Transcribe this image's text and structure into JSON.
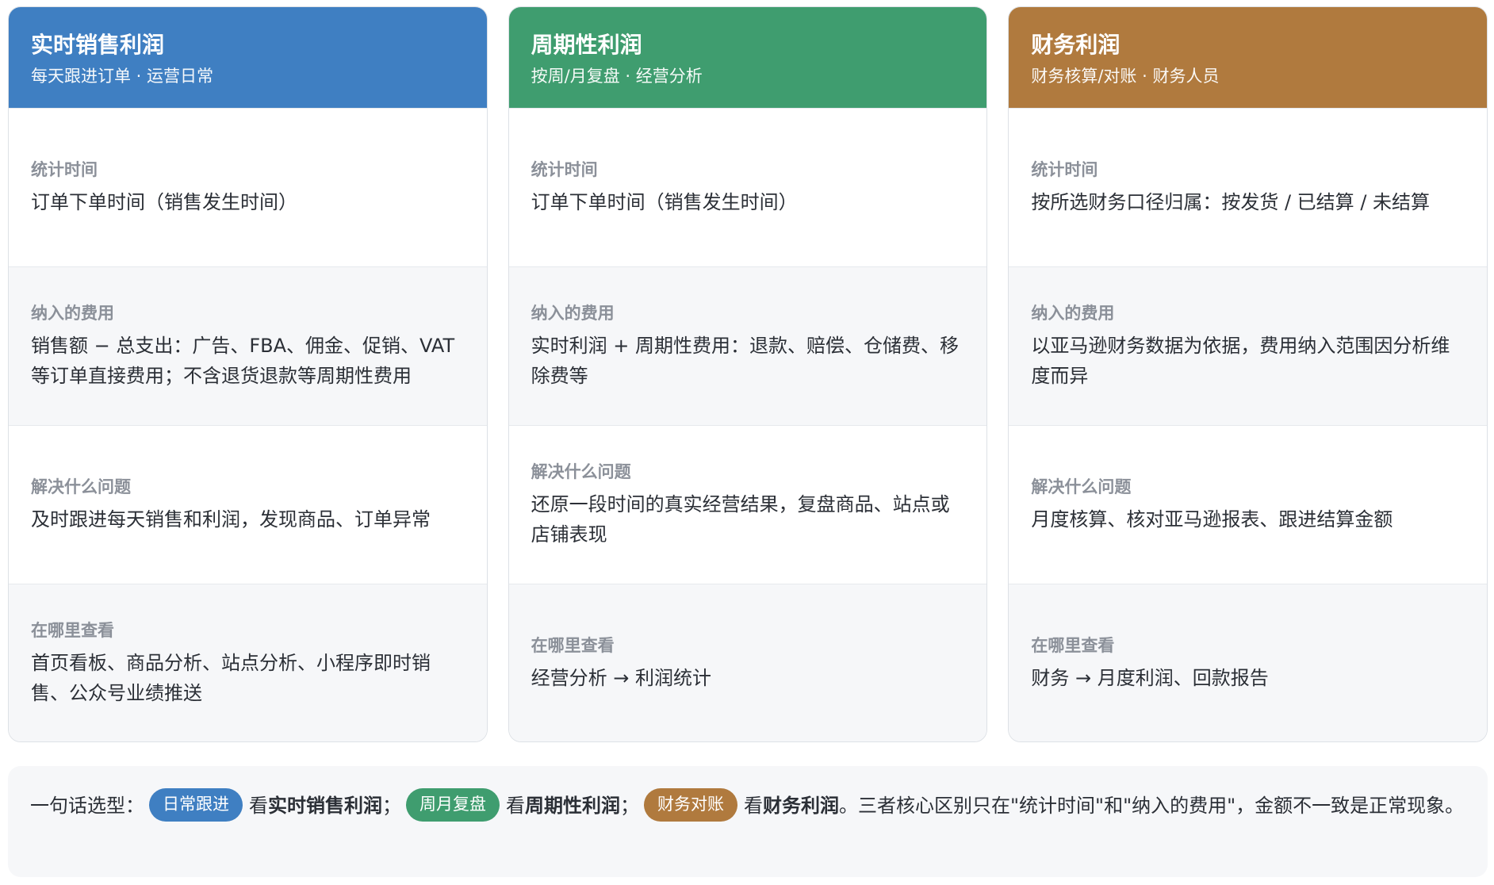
{
  "cards": [
    {
      "title": "实时销售利润",
      "subtitle": "每天跟进订单 · 运营日常",
      "color": "#3f7fc2",
      "sections": [
        {
          "label": "统计时间",
          "value": "订单下单时间（销售发生时间）"
        },
        {
          "label": "纳入的费用",
          "value": "销售额 − 总支出：广告、FBA、佣金、促销、VAT 等订单直接费用；不含退货退款等周期性费用"
        },
        {
          "label": "解决什么问题",
          "value": "及时跟进每天销售和利润，发现商品、订单异常"
        },
        {
          "label": "在哪里查看",
          "value": "首页看板、商品分析、站点分析、小程序即时销售、公众号业绩推送"
        }
      ]
    },
    {
      "title": "周期性利润",
      "subtitle": "按周/月复盘 · 经营分析",
      "color": "#3f9d6f",
      "sections": [
        {
          "label": "统计时间",
          "value": "订单下单时间（销售发生时间）"
        },
        {
          "label": "纳入的费用",
          "value": "实时利润 + 周期性费用：退款、赔偿、仓储费、移除费等"
        },
        {
          "label": "解决什么问题",
          "value": "还原一段时间的真实经营结果，复盘商品、站点或店铺表现"
        },
        {
          "label": "在哪里查看",
          "value": "经营分析 → 利润统计"
        }
      ]
    },
    {
      "title": "财务利润",
      "subtitle": "财务核算/对账 · 财务人员",
      "color": "#b07a3e",
      "sections": [
        {
          "label": "统计时间",
          "value": "按所选财务口径归属：按发货 / 已结算 / 未结算"
        },
        {
          "label": "纳入的费用",
          "value": "以亚马逊财务数据为依据，费用纳入范围因分析维度而异"
        },
        {
          "label": "解决什么问题",
          "value": "月度核算、核对亚马逊报表、跟进结算金额"
        },
        {
          "label": "在哪里查看",
          "value": "财务 → 月度利润、回款报告"
        }
      ]
    }
  ],
  "summary": {
    "lead": "一句话选型：",
    "tag1": "日常跟进",
    "text1": "看",
    "strong1": "实时销售利润",
    "sep1": "；",
    "tag2": "周月复盘",
    "text2": "看",
    "strong2": "周期性利润",
    "sep2": "；",
    "tag3": "财务对账",
    "text3": "看",
    "strong3": "财务利润",
    "tail": "。三者核心区别只在\"统计时间\"和\"纳入的费用\"，金额不一致是正常现象。"
  }
}
